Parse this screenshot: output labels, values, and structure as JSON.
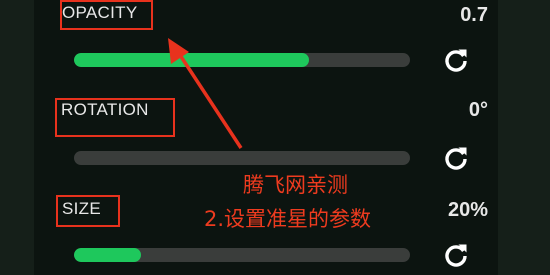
{
  "settings": [
    {
      "key": "opacity",
      "label": "OPACITY",
      "value": "0.7",
      "fill_fraction": 0.7
    },
    {
      "key": "rotation",
      "label": "ROTATION",
      "value": "0°",
      "fill_fraction": 0.0
    },
    {
      "key": "size",
      "label": "SIZE",
      "value": "20%",
      "fill_fraction": 0.2
    }
  ],
  "annotation": {
    "line1": "腾飞网亲测",
    "line2": "2.设置准星的参数"
  },
  "icons": {
    "reset": "refresh-icon",
    "pointer": "arrow-annotation"
  },
  "colors": {
    "accent": "#1ec85c",
    "annotation": "#e8321d",
    "track": "#3a3d3b"
  }
}
